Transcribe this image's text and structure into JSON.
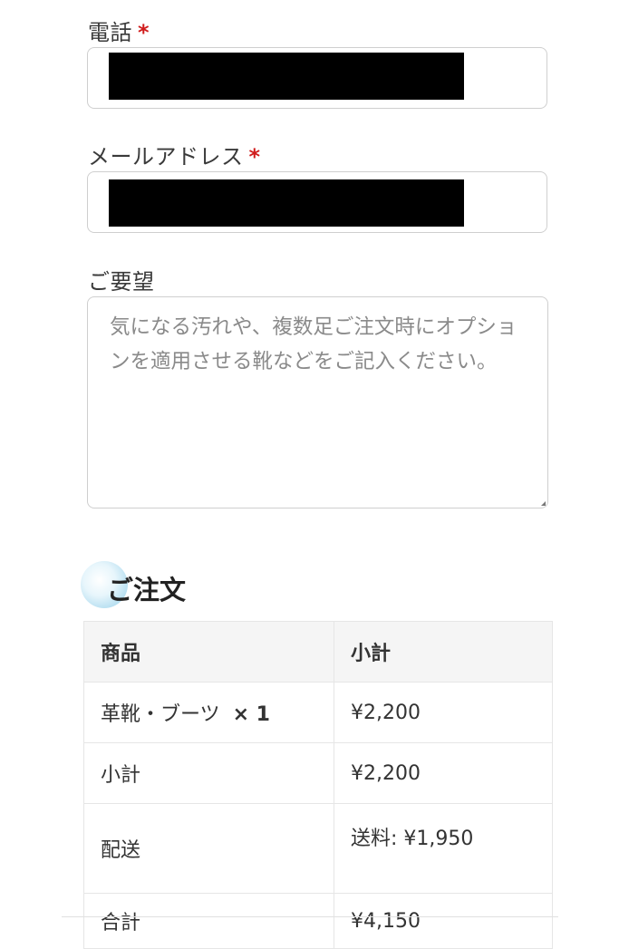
{
  "form": {
    "phone": {
      "label": "電話",
      "required_mark": "*"
    },
    "email": {
      "label": "メールアドレス",
      "required_mark": "*"
    },
    "request": {
      "label": "ご要望",
      "placeholder": "気になる汚れや、複数足ご注文時にオプションを適用させる靴などをご記入ください。"
    }
  },
  "order": {
    "title": "ご注文",
    "headers": {
      "product": "商品",
      "subtotal": "小計"
    },
    "item": {
      "name": "革靴・ブーツ",
      "qty": "× 1",
      "price": "¥2,200"
    },
    "subtotal": {
      "label": "小計",
      "value": "¥2,200"
    },
    "shipping": {
      "label": "配送",
      "value": "送料: ¥1,950"
    },
    "total": {
      "label": "合計",
      "value": "¥4,150"
    }
  }
}
